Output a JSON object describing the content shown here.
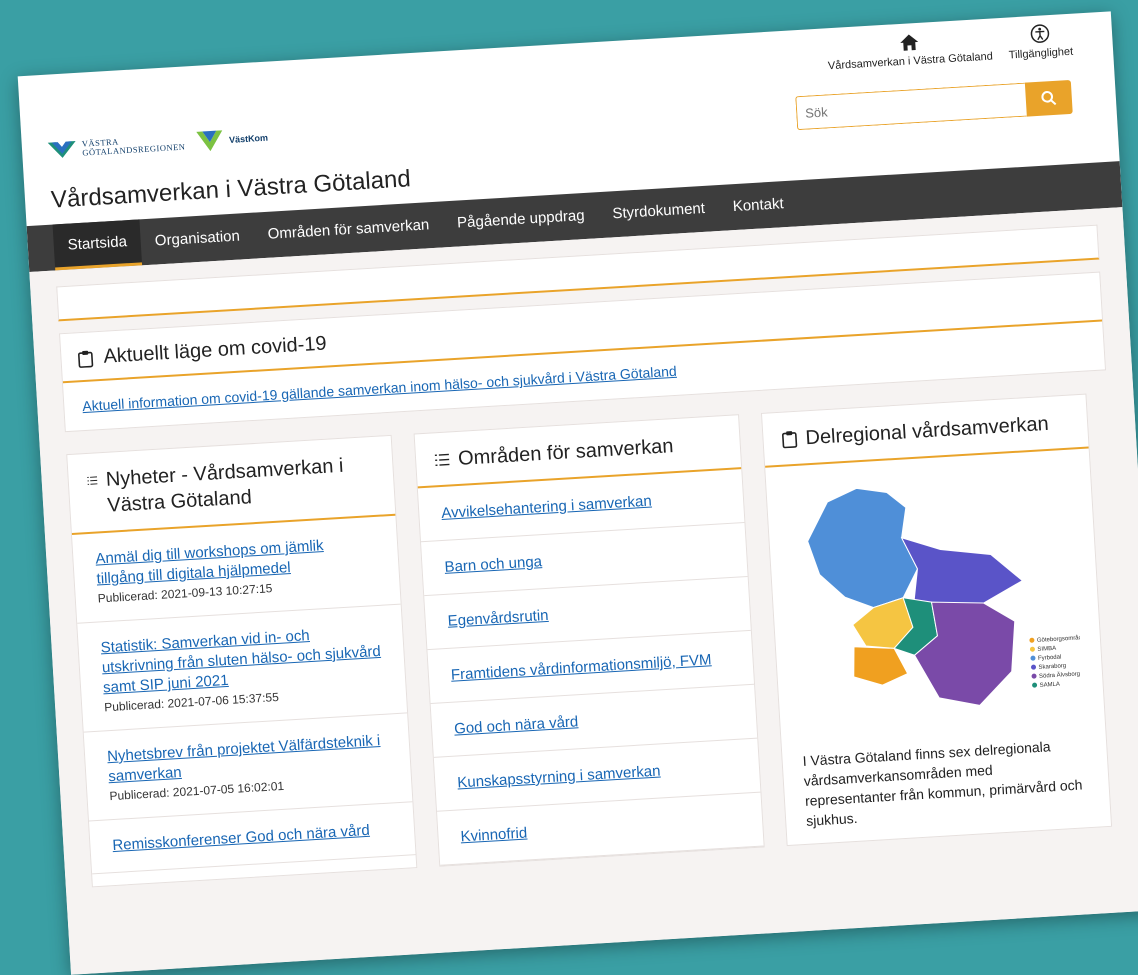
{
  "header": {
    "logo_vg_line1": "VÄSTRA",
    "logo_vg_line2": "GÖTALANDSREGIONEN",
    "logo_vk": "VästKom",
    "site_title": "Vårdsamverkan i Västra Götaland",
    "home_link": "Vårdsamverkan i Västra Götaland",
    "accessibility_link": "Tillgänglighet",
    "search_placeholder": "Sök"
  },
  "nav": {
    "items": [
      {
        "label": "Startsida",
        "active": true
      },
      {
        "label": "Organisation"
      },
      {
        "label": "Områden för samverkan"
      },
      {
        "label": "Pågående uppdrag"
      },
      {
        "label": "Styrdokument"
      },
      {
        "label": "Kontakt"
      }
    ]
  },
  "covid": {
    "title": "Aktuellt läge om covid-19",
    "link": "Aktuell information om covid-19 gällande samverkan inom hälso- och sjukvård i Västra Götaland"
  },
  "news": {
    "title": "Nyheter - Vårdsamverkan i Västra Götaland",
    "items": [
      {
        "title": "Anmäl dig till workshops om jämlik tillgång till digitala hjälpmedel",
        "published": "Publicerad: 2021-09-13 10:27:15"
      },
      {
        "title": "Statistik: Samverkan vid in- och utskrivning från sluten hälso- och sjukvård samt SIP juni 2021",
        "published": "Publicerad: 2021-07-06 15:37:55"
      },
      {
        "title": "Nyhetsbrev från projektet Välfärdsteknik i samverkan",
        "published": "Publicerad: 2021-07-05 16:02:01"
      },
      {
        "title": "Remisskonferenser God och nära vård",
        "published": ""
      }
    ]
  },
  "areas": {
    "title": "Områden för samverkan",
    "items": [
      "Avvikelsehantering i samverkan",
      "Barn och unga",
      "Egenvårdsrutin",
      "Framtidens vårdinformationsmiljö, FVM",
      "God och nära vård",
      "Kunskapsstyrning i samverkan",
      "Kvinnofrid"
    ]
  },
  "regional": {
    "title": "Delregional vårdsamverkan",
    "text": "I Västra Götaland finns sex delregionala vårdsamverkansområden med representanter från kommun, primärvård och sjukhus.",
    "legend": [
      {
        "label": "Göteborgsområdet",
        "color": "#f0a020"
      },
      {
        "label": "SIMBA",
        "color": "#f5c542"
      },
      {
        "label": "Fyrbodal",
        "color": "#4f8fd8"
      },
      {
        "label": "Skaraborg",
        "color": "#5a54c8"
      },
      {
        "label": "Södra Älvsborg",
        "color": "#7a4aa8"
      },
      {
        "label": "SAMLA",
        "color": "#1e8f7a"
      }
    ]
  },
  "colors": {
    "accent": "#e9a32a",
    "nav_bg": "#3d3d3d",
    "link": "#1866b4",
    "background": "#3a9fa4"
  }
}
